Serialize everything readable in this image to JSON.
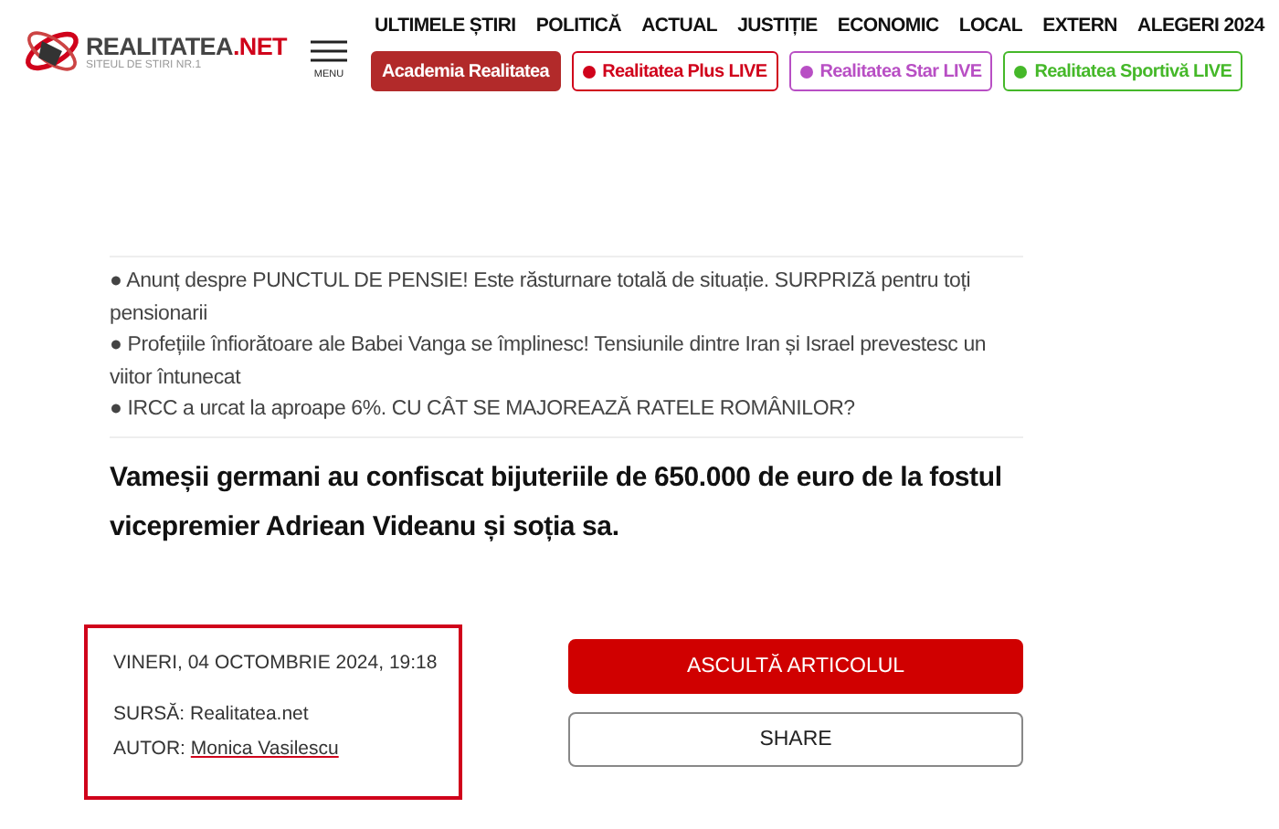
{
  "logo": {
    "name": "REALITATEA",
    "suffix": ".NET",
    "tagline": "SITEUL DE STIRI NR.1"
  },
  "menu": {
    "label": "MENU"
  },
  "nav": [
    "ULTIMELE ȘTIRI",
    "POLITICĂ",
    "ACTUAL",
    "JUSTIȚIE",
    "ECONOMIC",
    "LOCAL",
    "EXTERN",
    "ALEGERI 2024"
  ],
  "live_links": [
    {
      "kind": "solid",
      "label": "Academia Realitatea",
      "color": "#b22a2a"
    },
    {
      "kind": "outline",
      "label": "Realitatea Plus LIVE",
      "color": "#d0021b"
    },
    {
      "kind": "outline",
      "label": "Realitatea Star LIVE",
      "color": "#b84fc4"
    },
    {
      "kind": "outline",
      "label": "Realitatea Sportivă LIVE",
      "color": "#45b829"
    }
  ],
  "related": [
    "● Anunț despre PUNCTUL DE PENSIE! Este răsturnare totală de situație. SURPRIZă pentru toți pensionarii",
    "● Profețiile înfiorătoare ale Babei Vanga se împlinesc! Tensiunile dintre Iran și Israel prevestesc un viitor întunecat",
    "● IRCC a urcat la aproape 6%. CU CÂT SE MAJOREAZĂ RATELE ROMÂNILOR?"
  ],
  "headline": "Vameșii germani au confiscat bijuteriile de 650.000 de euro de la fostul vicepremier Adriean Videanu și soția sa.",
  "meta": {
    "date": "VINERI, 04 OCTOMBRIE 2024, 19:18",
    "source_label": "SURSĂ:",
    "source": "Realitatea.net",
    "author_label": "AUTOR:",
    "author": "Monica Vasilescu"
  },
  "actions": [
    {
      "kind": "primary",
      "label": "ASCULTĂ ARTICOLUL"
    },
    {
      "kind": "secondary",
      "label": "SHARE"
    }
  ]
}
